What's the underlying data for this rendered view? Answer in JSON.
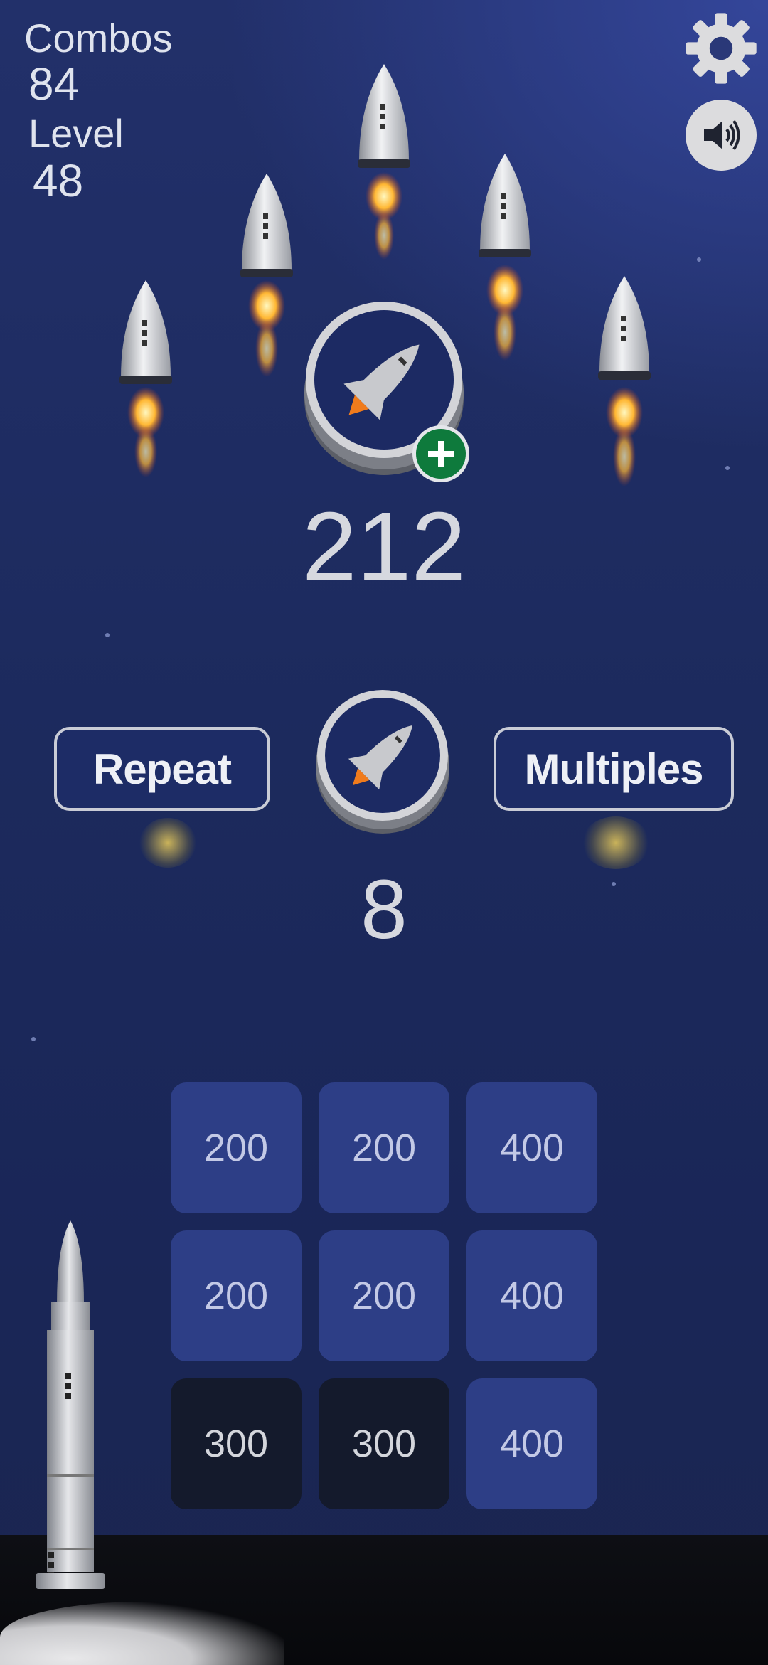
{
  "hud": {
    "combos_label": "Combos",
    "combos_value": "84",
    "level_label": "Level",
    "level_value": "48"
  },
  "counters": {
    "rockets_total": "212",
    "rockets_turn": "8"
  },
  "buttons": {
    "repeat_label": "Repeat",
    "multiples_label": "Multiples"
  },
  "grid": [
    [
      "200",
      "200",
      "400"
    ],
    [
      "200",
      "200",
      "400"
    ],
    [
      "300",
      "300",
      "400"
    ]
  ],
  "grid_state": [
    [
      "available",
      "available",
      "available"
    ],
    [
      "available",
      "available",
      "available"
    ],
    [
      "used",
      "used",
      "available"
    ]
  ],
  "icons": {
    "settings": "gear-icon",
    "sound": "speaker-icon",
    "add": "plus-icon",
    "coin": "space-shuttle-icon"
  },
  "colors": {
    "tile_available": "#2d3e86",
    "tile_used": "#141a2c",
    "add_badge": "#0e7a3c"
  }
}
